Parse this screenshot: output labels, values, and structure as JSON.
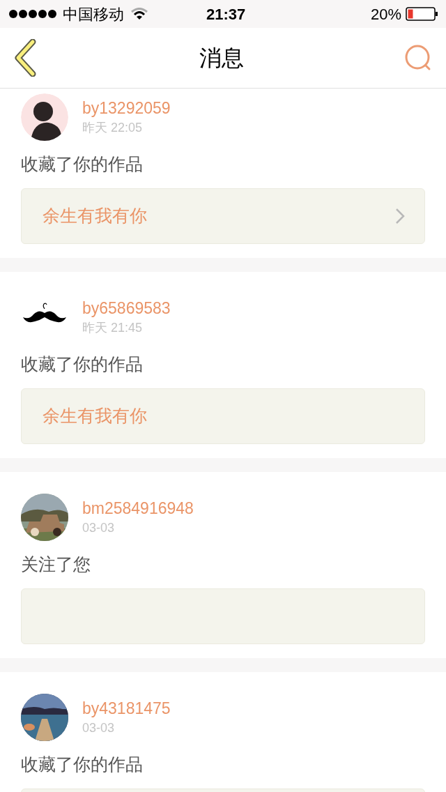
{
  "status_bar": {
    "carrier": "中国移动",
    "time": "21:37",
    "battery": "20%"
  },
  "nav": {
    "title": "消息"
  },
  "messages": [
    {
      "user": "by13292059",
      "time": "昨天 22:05",
      "action": "收藏了你的作品",
      "work": "余生有我有你"
    },
    {
      "user": "by65869583",
      "time": "昨天 21:45",
      "action": "收藏了你的作品",
      "work": "余生有我有你"
    },
    {
      "user": "bm2584916948",
      "time": "03-03",
      "action": "关注了您"
    },
    {
      "user": "by43181475",
      "time": "03-03",
      "action": "收藏了你的作品"
    }
  ]
}
